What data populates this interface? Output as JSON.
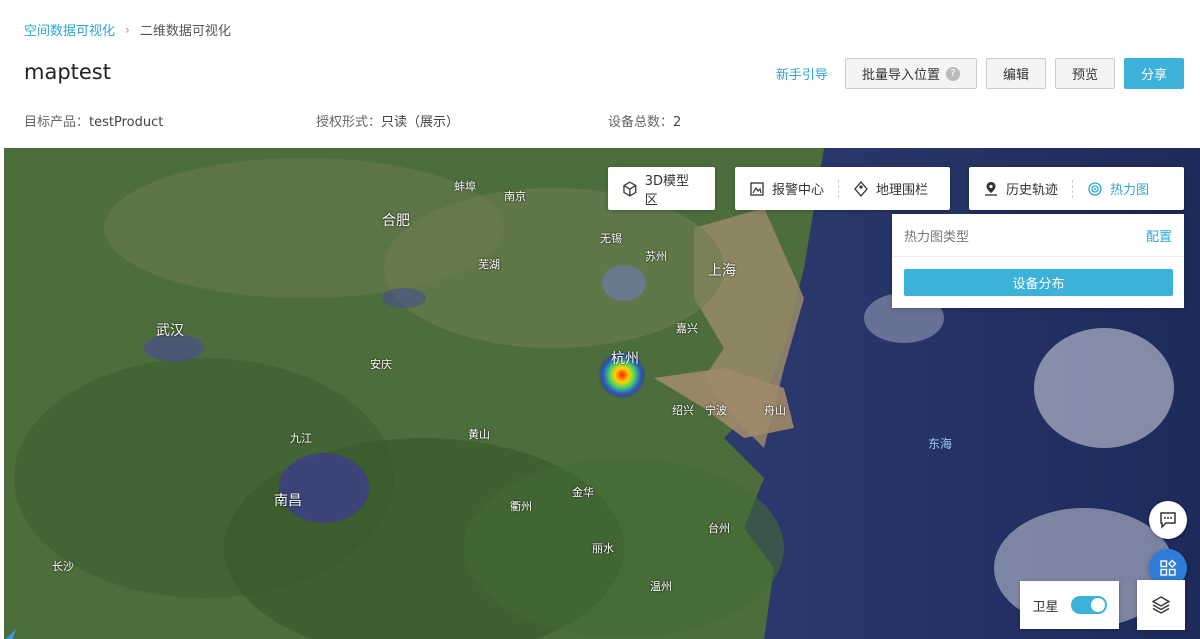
{
  "breadcrumb": {
    "parent": "空间数据可视化",
    "separator": "›",
    "current": "二维数据可视化"
  },
  "page": {
    "title": "maptest"
  },
  "actions": {
    "guide": "新手引导",
    "batch_import": "批量导入位置",
    "edit": "编辑",
    "preview": "预览",
    "share": "分享"
  },
  "meta": {
    "product_key": "目标产品：",
    "product_value": "testProduct",
    "auth_key": "授权形式：",
    "auth_value": "只读（展示）",
    "devices_key": "设备总数：",
    "devices_value": "2"
  },
  "toolbar": {
    "model3d": "3D模型区",
    "alarm": "报警中心",
    "geofence": "地理围栏",
    "history": "历史轨迹",
    "heatmap": "热力图"
  },
  "heat_panel": {
    "title": "热力图类型",
    "config": "配置",
    "button": "设备分布"
  },
  "map_labels": {
    "hangzhou": "杭州",
    "shanghai": "上海",
    "wuhan": "武汉",
    "hefei": "合肥",
    "nanchang": "南昌",
    "ningbo": "宁波",
    "donghai": "东海",
    "changsha": "长沙",
    "nanjing": "南京",
    "suzhou": "苏州",
    "wuxi": "无锡",
    "huangshan": "黄山",
    "jinhua": "金华",
    "taizhou": "台州",
    "lishui": "丽水",
    "zhoushan": "舟山",
    "jiujiang": "九江",
    "anqing": "安庆",
    "wuhu": "芜湖",
    "bengbu": "蚌埠",
    "quzhou": "衢州",
    "wenzhou": "温州",
    "jiaxing": "嘉兴",
    "shaoxing": "绍兴"
  },
  "satellite": {
    "label": "卫星",
    "on": true
  },
  "colors": {
    "accent": "#3cb1d9",
    "link": "#2ea6d6",
    "apps": "#2f7dd8"
  }
}
